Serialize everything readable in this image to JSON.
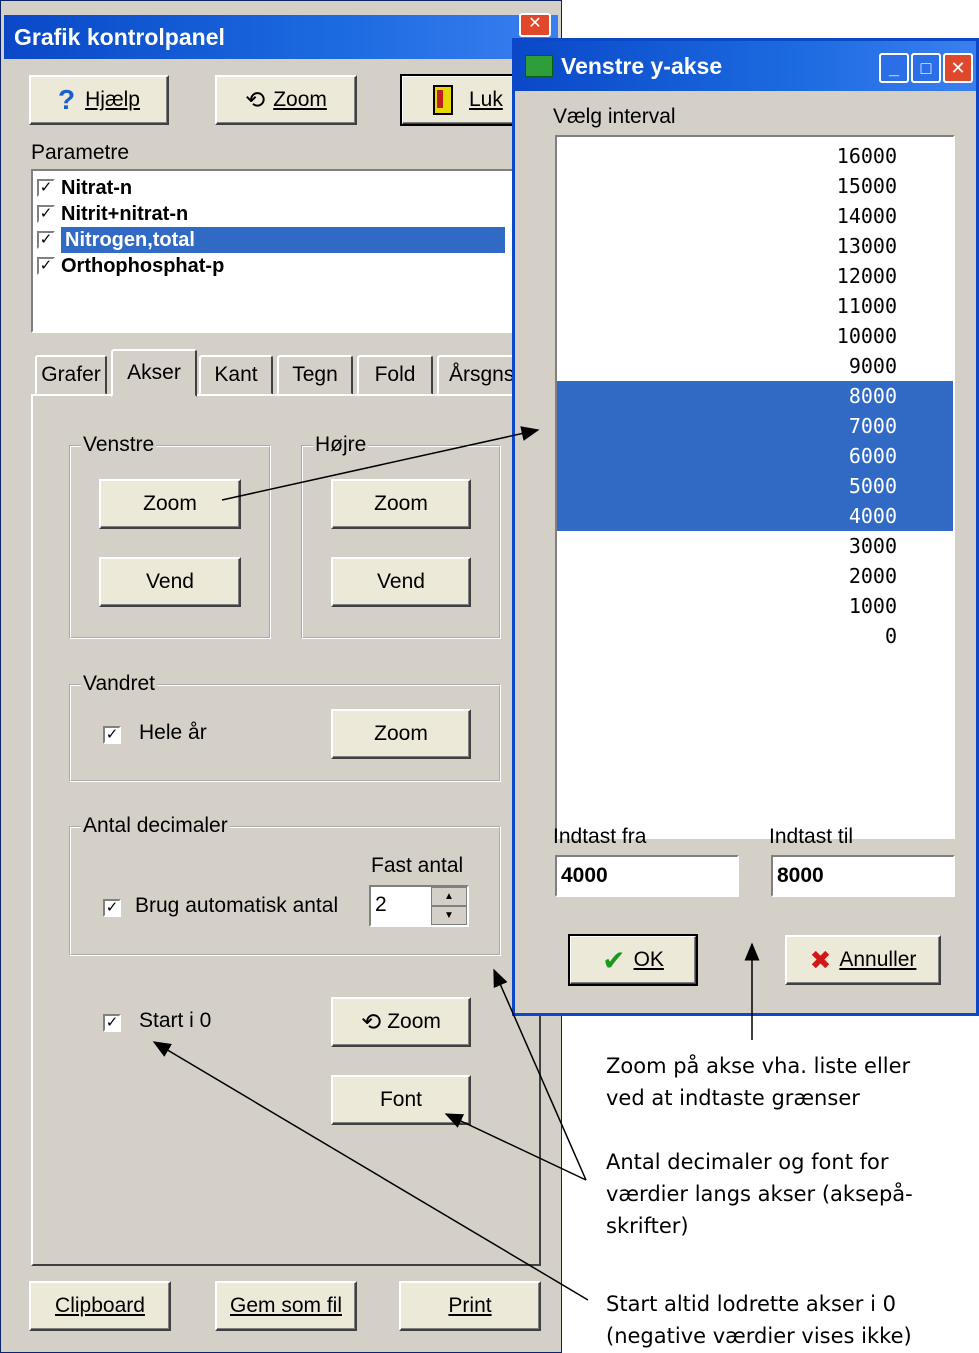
{
  "panel": {
    "title": "Grafik kontrolpanel",
    "help_label": "Hjælp",
    "zoom_label": "Zoom",
    "close_label": "Luk",
    "params_label": "Parametre",
    "params": [
      {
        "label": "Nitrat-n",
        "checked": true,
        "selected": false
      },
      {
        "label": "Nitrit+nitrat-n",
        "checked": true,
        "selected": false
      },
      {
        "label": "Nitrogen,total",
        "checked": true,
        "selected": true
      },
      {
        "label": "Orthophosphat-p",
        "checked": true,
        "selected": false
      }
    ],
    "tabs": [
      "Grafer",
      "Akser",
      "Kant",
      "Tegn",
      "Fold",
      "Årsgns"
    ],
    "active_tab": "Akser",
    "left_group": "Venstre",
    "right_group": "Højre",
    "zoom_btn": "Zoom",
    "flip_btn": "Vend",
    "horizontal_group": "Vandret",
    "whole_year": "Hele år",
    "decimals_group": "Antal decimaler",
    "fixed_count": "Fast antal",
    "auto_count": "Brug automatisk antal",
    "decimal_value": "2",
    "start_zero": "Start i 0",
    "zoom2_btn": "Zoom",
    "font_btn": "Font",
    "clipboard_btn": "Clipboard",
    "save_btn": "Gem som fil",
    "print_btn": "Print"
  },
  "dialog": {
    "title": "Venstre y-akse",
    "choose_interval": "Vælg interval",
    "values": [
      "16000",
      "15000",
      "14000",
      "13000",
      "12000",
      "11000",
      "10000",
      "9000",
      "8000",
      "7000",
      "6000",
      "5000",
      "4000",
      "3000",
      "2000",
      "1000",
      "0"
    ],
    "selected_values": [
      "8000",
      "7000",
      "6000",
      "5000",
      "4000"
    ],
    "from_label": "Indtast fra",
    "to_label": "Indtast til",
    "from_value": "4000",
    "to_value": "8000",
    "ok_label": "OK",
    "cancel_label": "Annuller"
  },
  "notes": {
    "zoom_note_1": "Zoom på akse vha. liste eller",
    "zoom_note_2": "ved at indtaste grænser",
    "decimals_note_1": "Antal decimaler og font for",
    "decimals_note_2": "værdier langs akser (aksepå-",
    "decimals_note_3": "skrifter)",
    "start_note_1": "Start altid lodrette akser i 0",
    "start_note_2": "(negative værdier vises ikke)"
  },
  "colors": {
    "titlebar": "#0a48c8",
    "selection": "#316ac5",
    "face": "#d4d0c8",
    "close": "#e0482b"
  }
}
